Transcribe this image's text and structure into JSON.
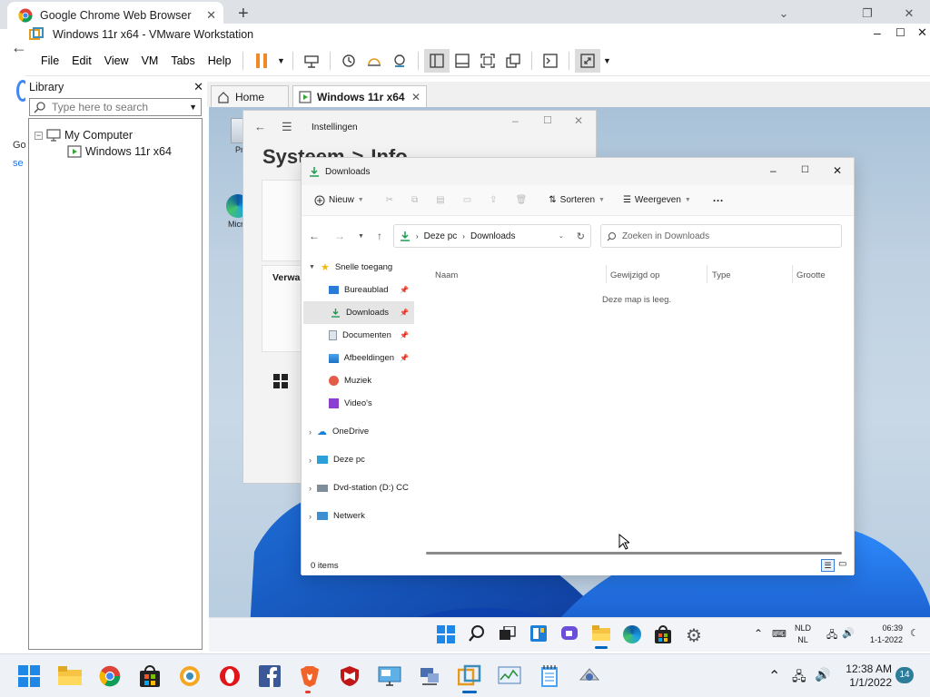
{
  "chrome": {
    "tab_title": "Google Chrome Web Browser",
    "new_tab": "+",
    "left_partial_1": "Go",
    "left_partial_2": "se"
  },
  "vmware": {
    "title": "Windows 11r x64 - VMware Workstation",
    "menu": [
      "File",
      "Edit",
      "View",
      "VM",
      "Tabs",
      "Help"
    ],
    "library": {
      "title": "Library",
      "search_placeholder": "Type here to search",
      "tree_root": "My Computer",
      "tree_child": "Windows 11r x64"
    },
    "tabs": {
      "home": "Home",
      "vm": "Windows 11r x64"
    }
  },
  "guest": {
    "desktop_icons": [
      "Pru",
      "Micro"
    ],
    "settings": {
      "title": "Instellingen",
      "heading_1": "Systeem",
      "heading_sep": ">",
      "heading_2": "Info",
      "side_label": "Verwa"
    },
    "explorer": {
      "title": "Downloads",
      "toolbar": {
        "new": "Nieuw",
        "sort": "Sorteren",
        "view": "Weergeven",
        "more": "···"
      },
      "address": {
        "root": "Deze pc",
        "folder": "Downloads"
      },
      "search_placeholder": "Zoeken in Downloads",
      "columns": [
        "Naam",
        "Gewijzigd op",
        "Type",
        "Grootte"
      ],
      "empty_message": "Deze map is leeg.",
      "quick_access": "Snelle toegang",
      "sidebar": [
        "Bureaublad",
        "Downloads",
        "Documenten",
        "Afbeeldingen",
        "Muziek",
        "Video's"
      ],
      "sidebar_groups": [
        "OneDrive",
        "Deze pc",
        "Dvd-station (D:) CC",
        "Netwerk"
      ],
      "status": "0 items"
    },
    "taskbar": {
      "lang_1": "NLD",
      "lang_2": "NL",
      "time": "06:39",
      "date": "1-1-2022"
    }
  },
  "host_taskbar": {
    "time": "12:38 AM",
    "date": "1/1/2022",
    "notif_count": "14"
  },
  "colors": {
    "accent": "#0067c0",
    "vmware_orange": "#f39c12",
    "chrome_tab_bg": "#dee1e6"
  }
}
